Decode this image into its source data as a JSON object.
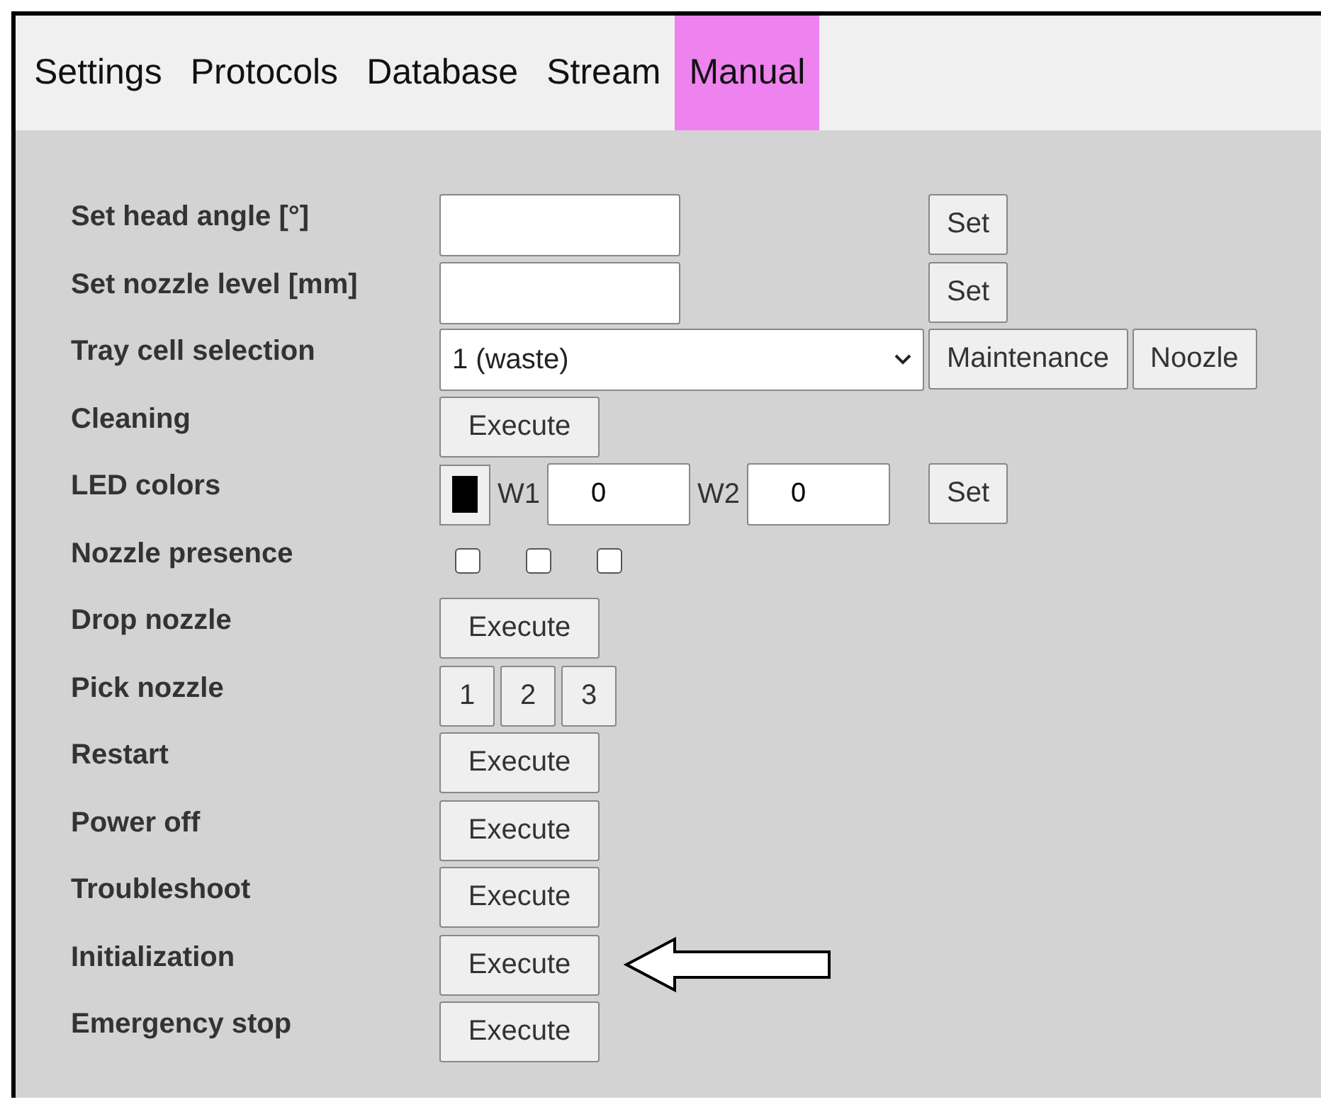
{
  "tabs": [
    {
      "label": "Settings",
      "selected": false
    },
    {
      "label": "Protocols",
      "selected": false
    },
    {
      "label": "Database",
      "selected": false
    },
    {
      "label": "Stream",
      "selected": false
    },
    {
      "label": "Manual",
      "selected": true
    }
  ],
  "rows": [
    {
      "kind": "input",
      "label": "Set head angle [°]",
      "button": "Set"
    },
    {
      "kind": "input",
      "label": "Set nozzle level [mm]",
      "button": "Set"
    },
    {
      "kind": "select",
      "label": "Tray cell selection",
      "value": "1 (waste)",
      "buttons": [
        "Maintenance",
        "Noozle"
      ]
    },
    {
      "kind": "execute",
      "label": "Cleaning",
      "button": "Execute",
      "pointer": false
    },
    {
      "kind": "led",
      "label": "LED colors",
      "color": "#000000",
      "fields": [
        {
          "label": "W1",
          "value": "0"
        },
        {
          "label": "W2",
          "value": "0"
        }
      ],
      "button": "Set"
    },
    {
      "kind": "checkboxes",
      "label": "Nozzle presence",
      "checkboxes": [
        {
          "checked": false
        },
        {
          "checked": false
        },
        {
          "checked": false
        }
      ]
    },
    {
      "kind": "execute",
      "label": "Drop nozzle",
      "button": "Execute",
      "pointer": false
    },
    {
      "kind": "numbers",
      "label": "Pick nozzle",
      "buttons": [
        "1",
        "2",
        "3"
      ]
    },
    {
      "kind": "execute",
      "label": "Restart",
      "button": "Execute",
      "pointer": false
    },
    {
      "kind": "execute",
      "label": "Power off",
      "button": "Execute",
      "pointer": false
    },
    {
      "kind": "execute",
      "label": "Troubleshoot",
      "button": "Execute",
      "pointer": false
    },
    {
      "kind": "execute",
      "label": "Initialization",
      "button": "Execute",
      "pointer": true
    },
    {
      "kind": "execute",
      "label": "Emergency stop",
      "button": "Execute",
      "pointer": false
    }
  ]
}
